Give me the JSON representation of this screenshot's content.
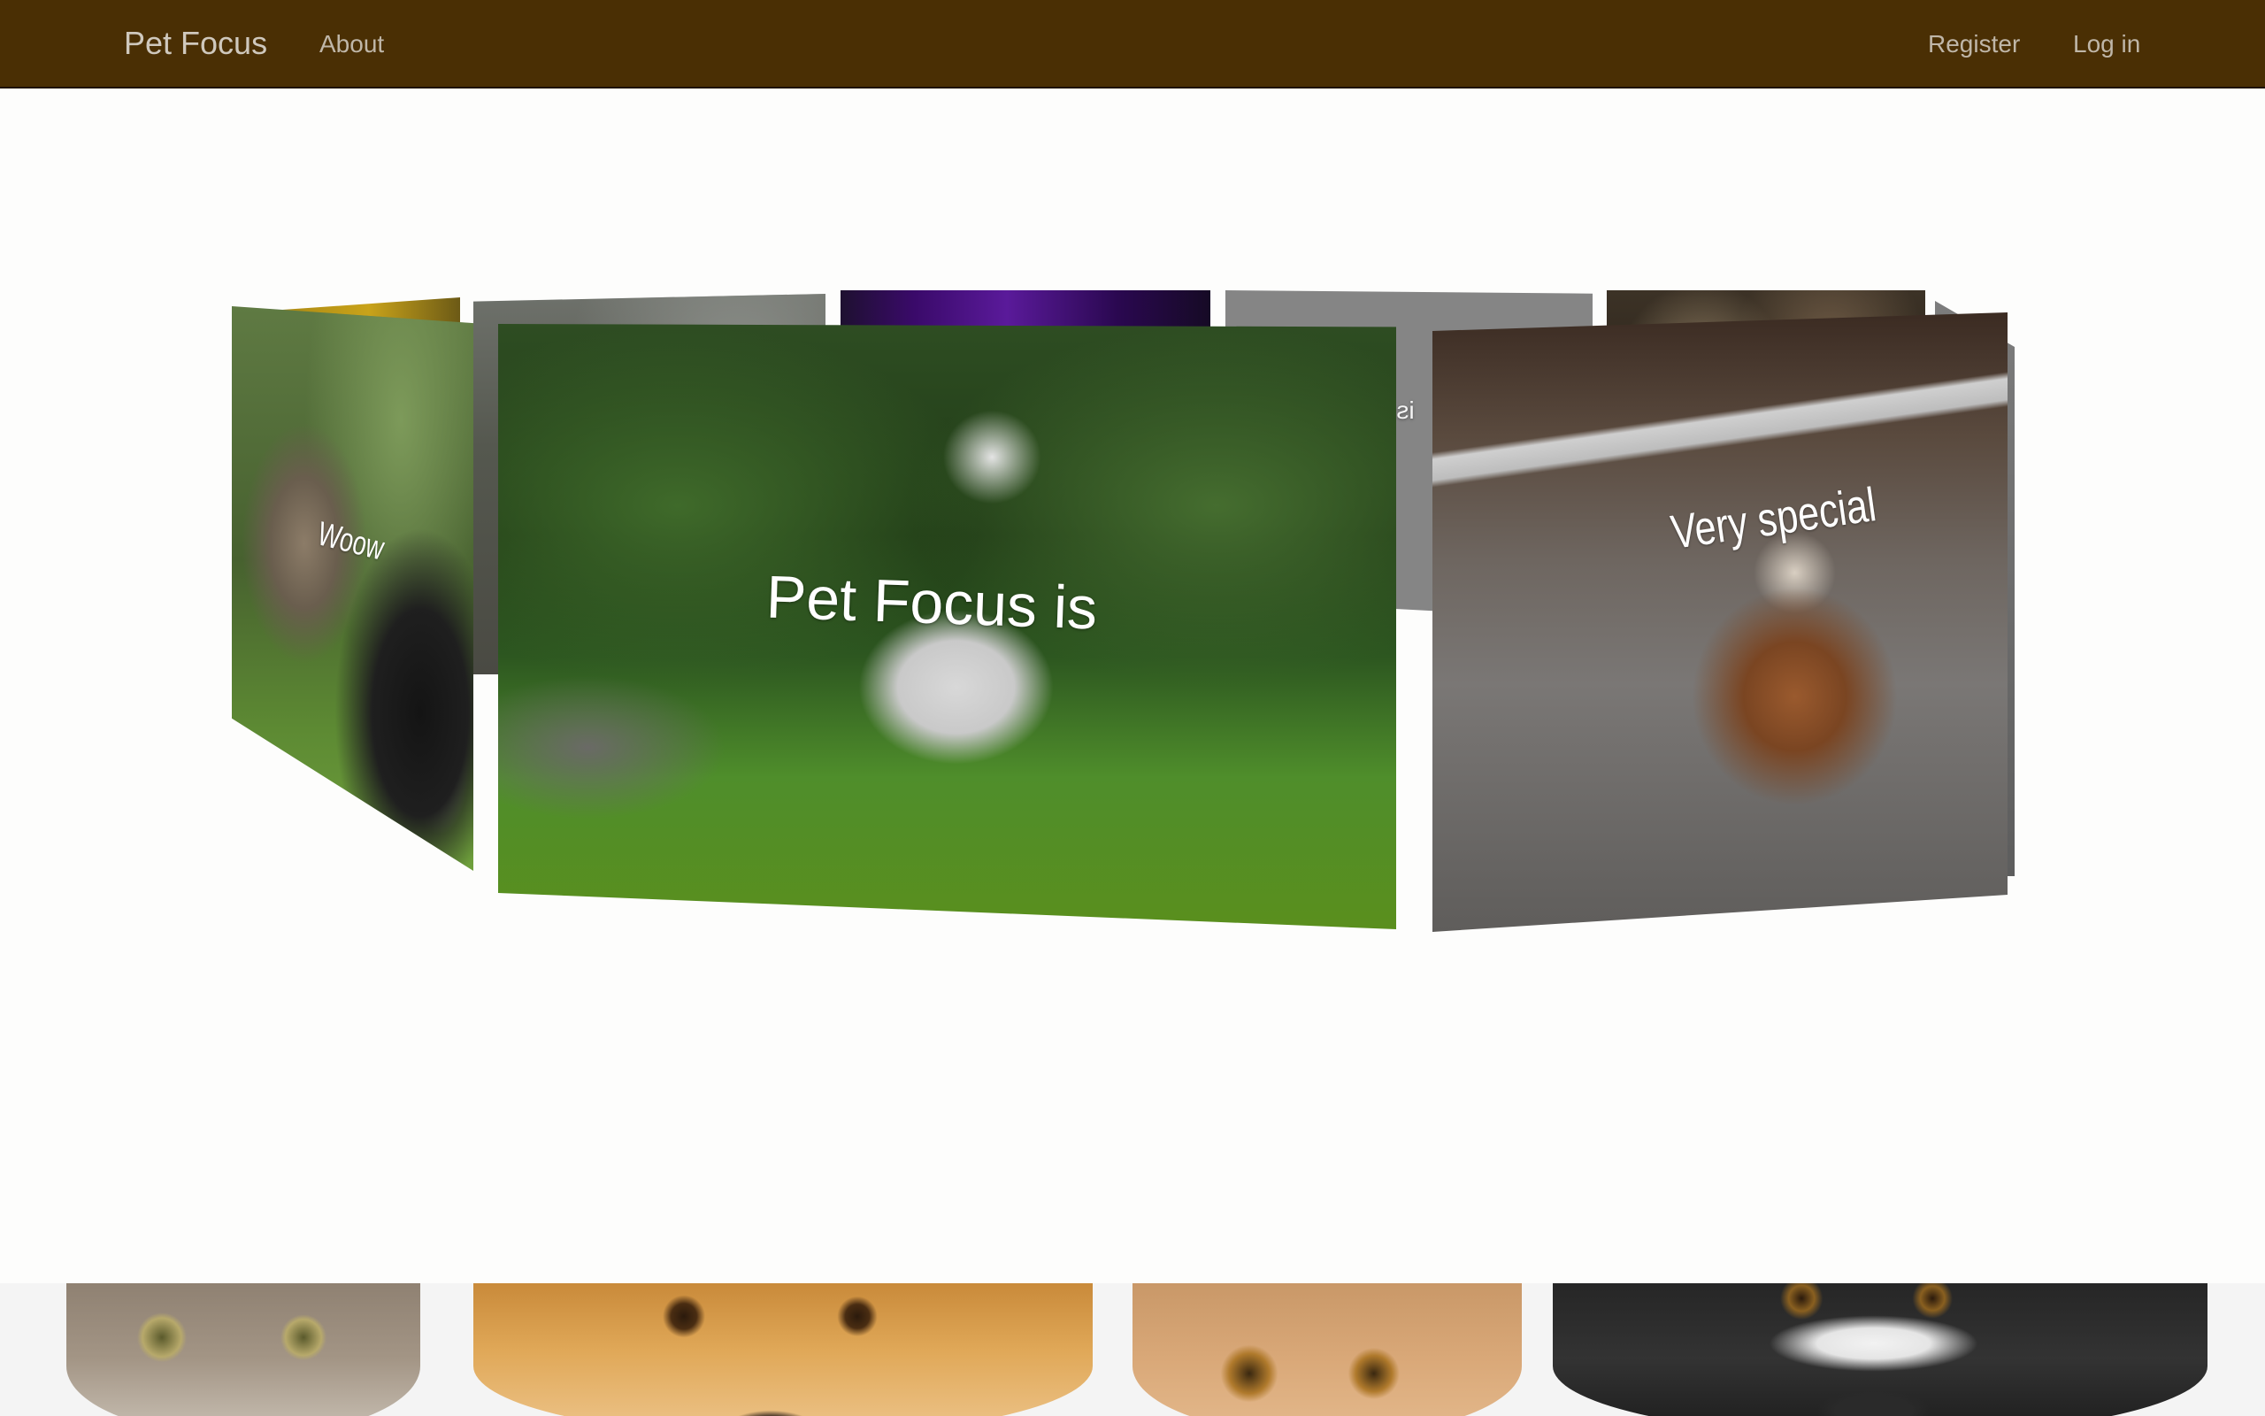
{
  "navbar": {
    "brand": "Pet Focus",
    "about": "About",
    "register": "Register",
    "login": "Log in",
    "background_color": "#4a2f04"
  },
  "carousel": {
    "slides": [
      {
        "caption": "Woow",
        "position": "left"
      },
      {
        "caption": "Pet Focus is",
        "position": "front"
      },
      {
        "caption": "Very special",
        "position": "right"
      },
      {
        "caption": "is g",
        "position": "back",
        "mirrored": true
      }
    ]
  },
  "banner": {
    "description_icon": "pets-banner-image"
  }
}
